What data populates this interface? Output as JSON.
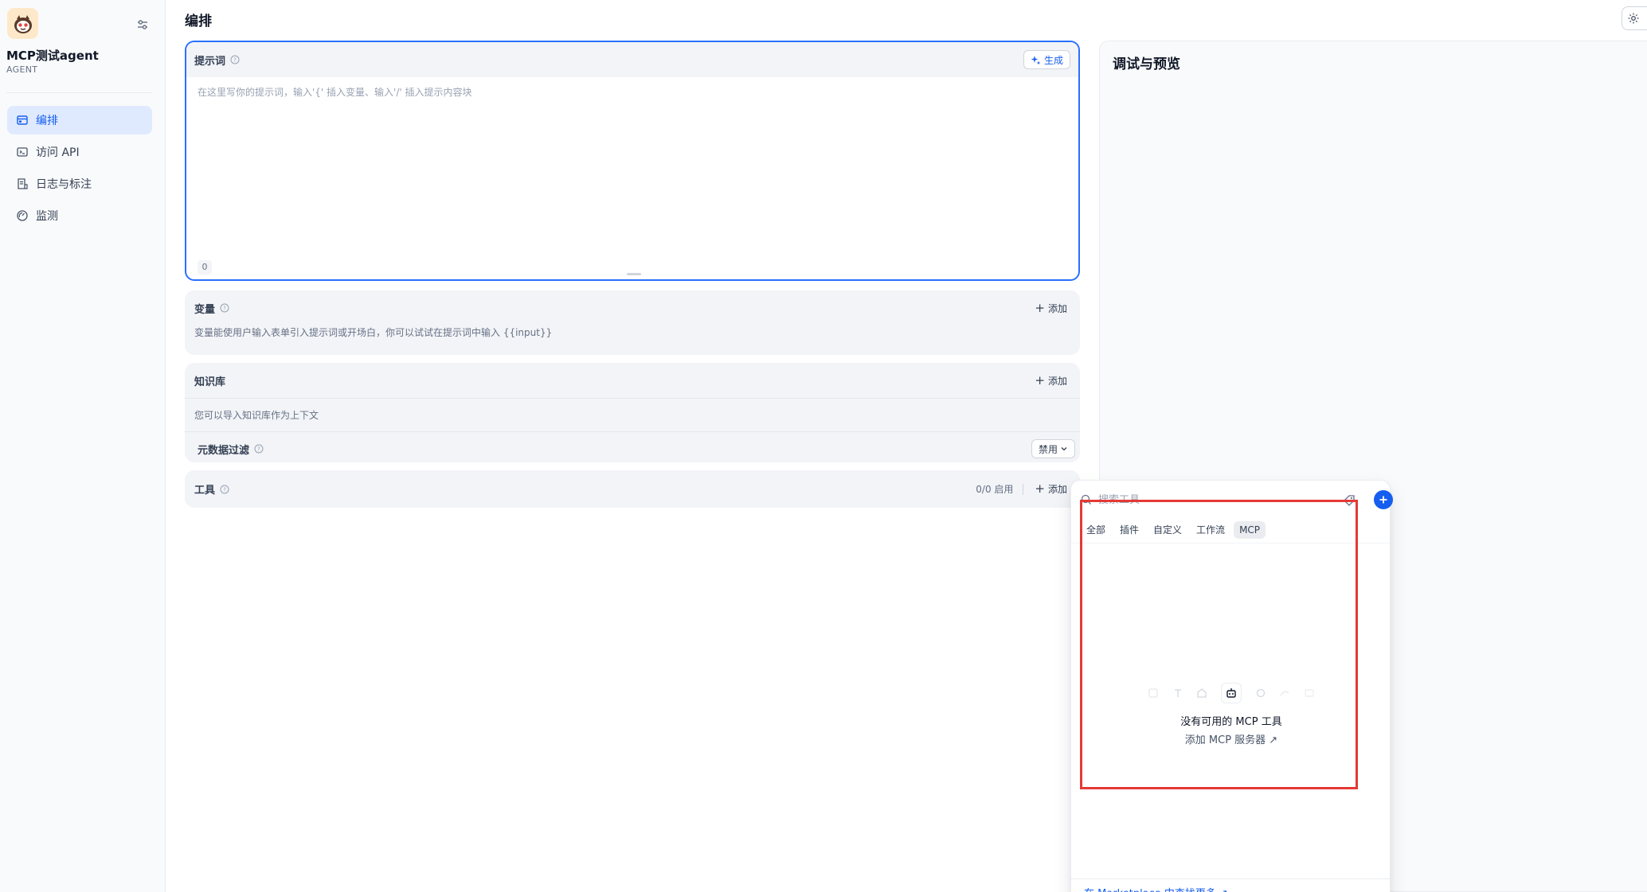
{
  "sidebar": {
    "app_name": "MCP测试agent",
    "app_type": "AGENT",
    "items": [
      {
        "label": "编排",
        "icon": "layout-icon",
        "active": true
      },
      {
        "label": "访问 API",
        "icon": "terminal-icon",
        "active": false
      },
      {
        "label": "日志与标注",
        "icon": "file-list-icon",
        "active": false
      },
      {
        "label": "监测",
        "icon": "dashboard-icon",
        "active": false
      }
    ]
  },
  "header": {
    "title": "编排"
  },
  "prompt": {
    "title": "提示词",
    "generate_label": "生成",
    "placeholder": "在这里写你的提示词，输入'{' 插入变量、输入'/' 插入提示内容块",
    "char_count": "0"
  },
  "variables": {
    "title": "变量",
    "add_label": "添加",
    "description": "变量能使用户输入表单引入提示词或开场白，你可以试试在提示词中输入 {{input}}"
  },
  "knowledge": {
    "title": "知识库",
    "add_label": "添加",
    "description": "您可以导入知识库作为上下文",
    "metadata_filter_label": "元数据过滤",
    "metadata_filter_value": "禁用"
  },
  "tools": {
    "title": "工具",
    "count": "0/0 启用",
    "add_label": "添加"
  },
  "debug": {
    "title": "调试与预览"
  },
  "tool_picker": {
    "search_placeholder": "搜索工具",
    "tabs": [
      "全部",
      "插件",
      "自定义",
      "工作流",
      "MCP"
    ],
    "active_tab": "MCP",
    "empty_title": "没有可用的 MCP 工具",
    "empty_link": "添加 MCP 服务器 ↗",
    "marketplace_link": "在 Marketplace 中查找更多 ↗"
  },
  "colors": {
    "accent": "#155eef",
    "highlight": "#e53935",
    "active_nav_bg": "#e0eaff"
  }
}
